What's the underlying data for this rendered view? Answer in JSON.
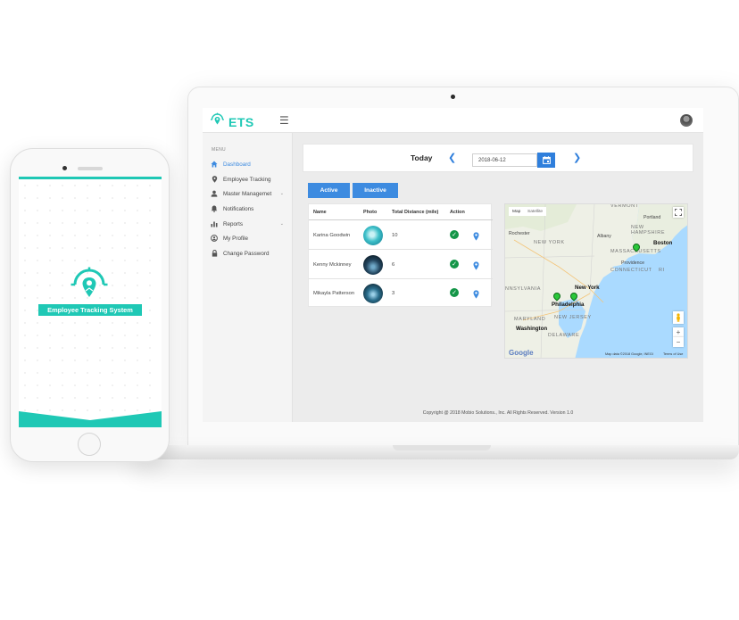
{
  "app": {
    "logo_text": "ETS"
  },
  "sidebar": {
    "heading": "MENU",
    "items": [
      {
        "label": "Dashboard"
      },
      {
        "label": "Employee Tracking"
      },
      {
        "label": "Master Managemet"
      },
      {
        "label": "Notifications"
      },
      {
        "label": "Reports"
      },
      {
        "label": "My Profile"
      },
      {
        "label": "Change Password"
      }
    ]
  },
  "datebar": {
    "today_label": "Today",
    "date_value": "2018-06-12"
  },
  "tabs": {
    "active": "Active",
    "inactive": "Inactive"
  },
  "table": {
    "headers": [
      "Name",
      "Photo",
      "Total Distance (mile)",
      "Action"
    ],
    "rows": [
      {
        "name": "Karina Goodwin",
        "distance": "10"
      },
      {
        "name": "Kenny Mckinney",
        "distance": "6"
      },
      {
        "name": "Mikayla Patterson",
        "distance": "3"
      }
    ]
  },
  "map": {
    "tabs": [
      "Map",
      "Satellite"
    ],
    "labels": {
      "vermont": "VERMONT",
      "portland": "Portland",
      "new_hampshire": "NEW\nHAMPSHIRE",
      "rochester": "Rochester",
      "new_york_state": "NEW YORK",
      "albany": "Albany",
      "massachusetts": "MASSACHUSETTS",
      "boston": "Boston",
      "providence": "Providence",
      "connecticut": "CONNECTICUT",
      "rhode_island": "RI",
      "pennsylvania": "NNSYLVANIA",
      "new_york_city": "New York",
      "philadelphia": "Philadelphia",
      "new_jersey": "NEW JERSEY",
      "maryland": "MARYLAND",
      "washington": "Washington",
      "delaware": "DELAWARE"
    },
    "google": "Google",
    "attribution": "Map data ©2018 Google, INEGI",
    "terms": "Terms of Use"
  },
  "footer": {
    "copyright": "Copyright @ 2018 Mobio Solutions., Inc. All Rights Reserved. Version 1.0"
  },
  "phone": {
    "banner_text": "Employee Tracking System"
  },
  "colors": {
    "brand_teal": "#1fc8b5",
    "accent_blue": "#3d8be0",
    "action_green": "#149648",
    "map_pin_green": "#2ac73a"
  }
}
